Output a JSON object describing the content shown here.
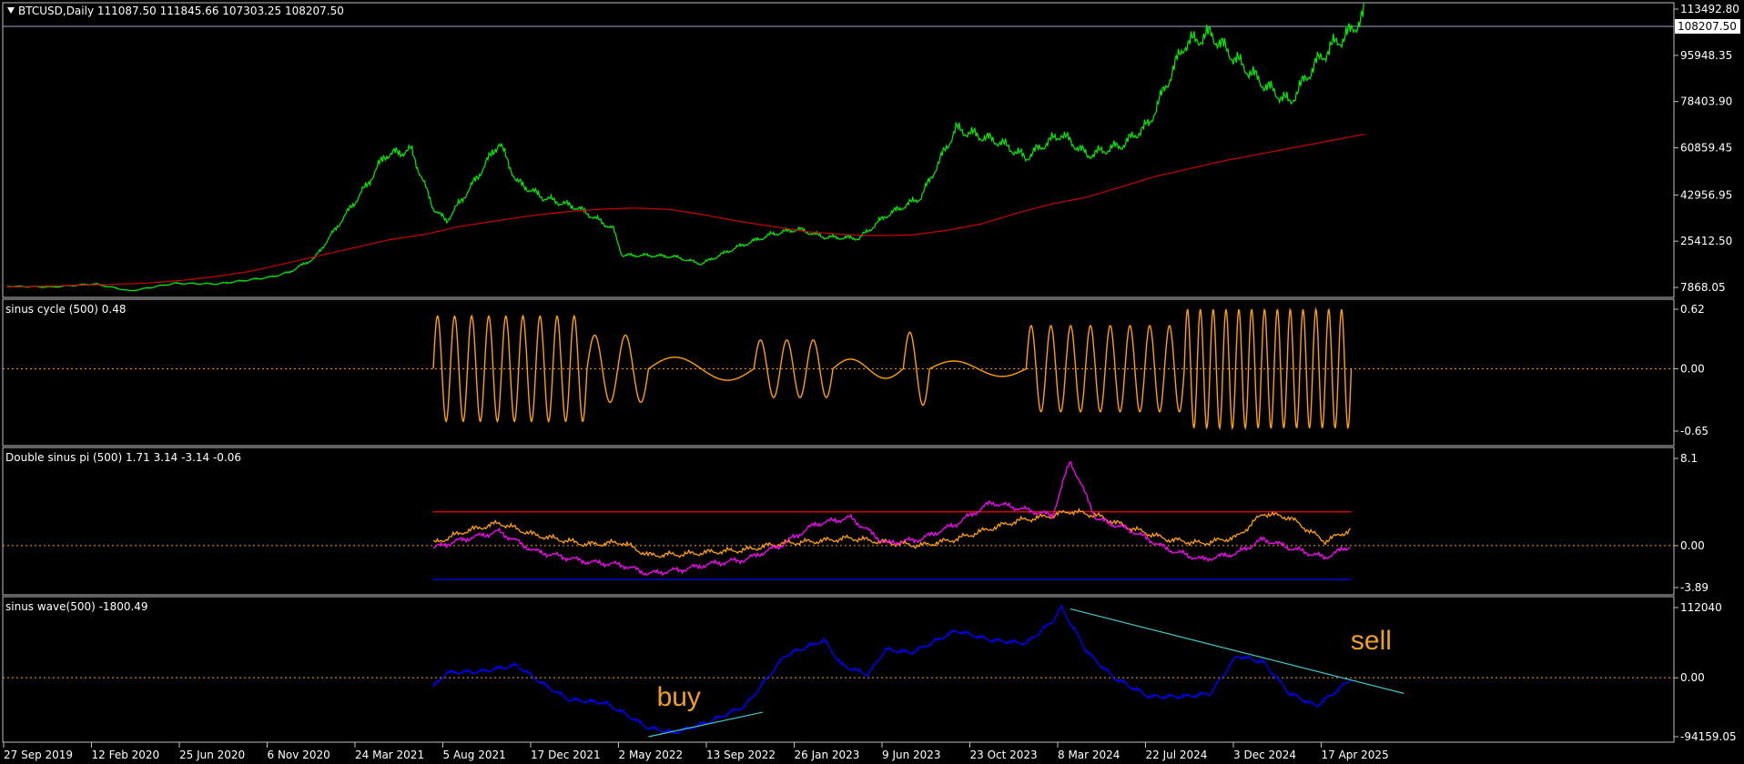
{
  "colors": {
    "background": "#000000",
    "axis": "#c0c0c0",
    "text": "#ffffff",
    "price": "#00ee00",
    "ma": "#cc0000",
    "cycle": "#ffa000",
    "double_orange": "#ffa000",
    "double_magenta": "#ff00ff",
    "level_top": "#ff0000",
    "level_bottom": "#0000ff",
    "wave": "#0000ff",
    "trendline": "#40c8c8",
    "zero": "#ffa000",
    "grid_hline": "#9aa4c8",
    "price_tag_bg": "#ffffff",
    "annotation": "#f0a020"
  },
  "x_axis": {
    "tick_labels": [
      "27 Sep 2019",
      "12 Feb 2020",
      "25 Jun 2020",
      "6 Nov 2020",
      "24 Mar 2021",
      "5 Aug 2021",
      "17 Dec 2021",
      "2 May 2022",
      "13 Sep 2022",
      "26 Jan 2023",
      "9 Jun 2023",
      "23 Oct 2023",
      "8 Mar 2024",
      "22 Jul 2024",
      "3 Dec 2024",
      "17 Apr 2025"
    ]
  },
  "panes": {
    "main": {
      "title_icon": "triangle-down-icon",
      "title": "BTCUSD,Daily  111087.50 111845.66 107303.25 108207.50",
      "y_ticks": [
        "113492.80",
        "95948.35",
        "78403.90",
        "60859.45",
        "42956.95",
        "25412.50",
        "7868.05"
      ],
      "current_price_label": "108207.50"
    },
    "cycle": {
      "title": "sinus cycle (500) 0.48",
      "y_ticks": [
        "0.62",
        "0.00",
        "-0.65"
      ]
    },
    "double": {
      "title": "Double sinus pi (500) 1.71 3.14 -3.14 -0.06",
      "y_ticks": [
        "8.1",
        "0.00",
        "-3.89"
      ]
    },
    "wave": {
      "title": "sinus wave(500) -1800.49",
      "y_ticks": [
        "112040",
        "0.00",
        "-94159.05"
      ],
      "annotations": [
        "buy",
        "sell"
      ]
    }
  },
  "chart_data": [
    {
      "type": "line",
      "title": "BTCUSD,Daily",
      "x_ticks": [
        "27 Sep 2019",
        "12 Feb 2020",
        "25 Jun 2020",
        "6 Nov 2020",
        "24 Mar 2021",
        "5 Aug 2021",
        "17 Dec 2021",
        "2 May 2022",
        "13 Sep 2022",
        "26 Jan 2023",
        "9 Jun 2023",
        "23 Oct 2023",
        "8 Mar 2024",
        "22 Jul 2024",
        "3 Dec 2024",
        "17 Apr 2025"
      ],
      "x": [
        0,
        0.5,
        1,
        1.4,
        1.9,
        2.4,
        3,
        3.2,
        3.5,
        3.8,
        4.1,
        4.3,
        4.6,
        4.85,
        5,
        5.3,
        5.6,
        5.8,
        6.1,
        6.5,
        6.9,
        7,
        7.3,
        7.6,
        7.9,
        8.3,
        8.7,
        9,
        9.3,
        9.7,
        10,
        10.4,
        10.8,
        11.3,
        11.6,
        11.8,
        12,
        12.3,
        12.7,
        13,
        13.4,
        13.7,
        14,
        14.3,
        14.6,
        14.9,
        15.1,
        15.3,
        15.45
      ],
      "x_unit": "position between x tick labels (0 = 27 Sep 2019, 15 = 17 Apr 2025)",
      "series": [
        {
          "values": [
            8300,
            8000,
            9200,
            6500,
            9400,
            9200,
            11800,
            13500,
            19000,
            33000,
            47000,
            58000,
            60000,
            38000,
            33000,
            47000,
            63000,
            48000,
            42000,
            38000,
            30000,
            20000,
            20000,
            19500,
            16800,
            23000,
            28000,
            30000,
            27000,
            26500,
            35000,
            42000,
            68000,
            63000,
            57000,
            62000,
            66000,
            58000,
            62000,
            70000,
            100000,
            104000,
            94000,
            85000,
            78000,
            93000,
            100000,
            105000,
            111845.66
          ]
        },
        {
          "values": [
            8000,
            8300,
            8700,
            9000,
            9500,
            10500,
            12000,
            14000,
            17000,
            20000,
            23000,
            26000,
            28000,
            31000,
            33000,
            35000,
            36500,
            37500,
            38000,
            37500,
            35500,
            33000,
            31000,
            29000,
            28000,
            27500,
            27800,
            29500,
            32000,
            36000,
            39500,
            42000,
            46000,
            50000,
            53000,
            56000,
            58500,
            61000,
            63500,
            66000
          ]
        }
      ],
      "ylim": [
        7868.05,
        113492.8
      ],
      "current_price": 108207.5
    },
    {
      "type": "line",
      "title": "sinus cycle (500) 0.48",
      "x_range": [
        4.85,
        15.3
      ],
      "series": [
        {
          "segments": [
            {
              "x": [
                4.85,
                6.6
              ],
              "cycles": 9,
              "amplitude": 0.55
            },
            {
              "x": [
                6.6,
                7.3
              ],
              "cycles": 2,
              "amplitude": 0.35
            },
            {
              "x": [
                7.3,
                8.5
              ],
              "cycles": 1,
              "amplitude": 0.12
            },
            {
              "x": [
                8.5,
                9.4
              ],
              "cycles": 3,
              "amplitude": 0.3
            },
            {
              "x": [
                9.4,
                10.2
              ],
              "cycles": 1,
              "amplitude": 0.1
            },
            {
              "x": [
                10.2,
                10.5
              ],
              "cycles": 1,
              "amplitude": 0.38
            },
            {
              "x": [
                10.5,
                11.6
              ],
              "cycles": 1,
              "amplitude": 0.08
            },
            {
              "x": [
                11.6,
                13.4
              ],
              "cycles": 8,
              "amplitude": 0.45
            },
            {
              "x": [
                13.4,
                15.3
              ],
              "cycles": 13,
              "amplitude": 0.62
            }
          ]
        }
      ],
      "ylim": [
        -0.65,
        0.62
      ]
    },
    {
      "type": "line",
      "title": "Double sinus pi (500) 1.71 3.14 -3.14 -0.06",
      "x": [
        4.85,
        5.2,
        5.6,
        6,
        6.6,
        7,
        7.3,
        7.7,
        8,
        8.4,
        8.8,
        9.2,
        9.6,
        10,
        10.4,
        10.8,
        11.2,
        11.5,
        11.9,
        12.1,
        12.4,
        12.8,
        13.2,
        13.6,
        14,
        14.3,
        14.6,
        15,
        15.3
      ],
      "series": [
        {
          "color_key": "double_orange",
          "values": [
            0.2,
            1.3,
            2.1,
            1.0,
            0.1,
            0.3,
            -0.9,
            -0.8,
            -0.6,
            -0.4,
            0.2,
            0.4,
            0.7,
            0.3,
            0.0,
            0.6,
            1.6,
            2.3,
            2.8,
            3.2,
            2.8,
            1.6,
            0.6,
            0.2,
            0.8,
            3.0,
            2.6,
            0.4,
            1.5
          ]
        },
        {
          "color_key": "double_magenta",
          "values": [
            -0.2,
            0.6,
            1.3,
            -0.5,
            -1.5,
            -1.8,
            -2.6,
            -2.2,
            -1.7,
            -1.3,
            0.0,
            2.0,
            2.6,
            0.2,
            0.6,
            2.0,
            4.0,
            3.5,
            2.8,
            7.9,
            2.5,
            1.4,
            -0.3,
            -1.3,
            -0.7,
            0.6,
            -0.2,
            -1.1,
            0.0
          ]
        }
      ],
      "levels": [
        3.14,
        -3.14
      ],
      "ylim": [
        -3.89,
        8.1
      ]
    },
    {
      "type": "line",
      "title": "sinus wave(500) -1800.49",
      "x": [
        4.85,
        5,
        5.4,
        5.8,
        6.1,
        6.4,
        6.8,
        7,
        7.3,
        7.6,
        8,
        8.4,
        8.6,
        8.85,
        9.3,
        9.5,
        9.8,
        10,
        10.3,
        10.8,
        11.2,
        11.6,
        11.9,
        12,
        12.3,
        12.6,
        13,
        13.4,
        13.7,
        14,
        14.3,
        14.6,
        14.9,
        15.1,
        15.3
      ],
      "series": [
        {
          "values": [
            -15000,
            8000,
            10000,
            20000,
            -10000,
            -35000,
            -40000,
            -55000,
            -80000,
            -88000,
            -70000,
            -45000,
            -10000,
            35000,
            60000,
            20000,
            5000,
            45000,
            40000,
            75000,
            60000,
            55000,
            90000,
            112040,
            40000,
            0,
            -30000,
            -30000,
            -25000,
            35000,
            25000,
            -25000,
            -45000,
            -25000,
            -1800.49
          ]
        }
      ],
      "trendlines": [
        {
          "x": [
            7.3,
            8.6
          ],
          "y": [
            -94159.05,
            -55000
          ]
        },
        {
          "x": [
            12.1,
            15.9
          ],
          "y": [
            110000,
            -25000
          ]
        }
      ],
      "annotations": [
        {
          "text": "buy",
          "x": 7.55,
          "y": -45000
        },
        {
          "text": "sell",
          "x": 15.45,
          "y": 45000
        }
      ],
      "ylim": [
        -94159.05,
        112040
      ]
    }
  ]
}
